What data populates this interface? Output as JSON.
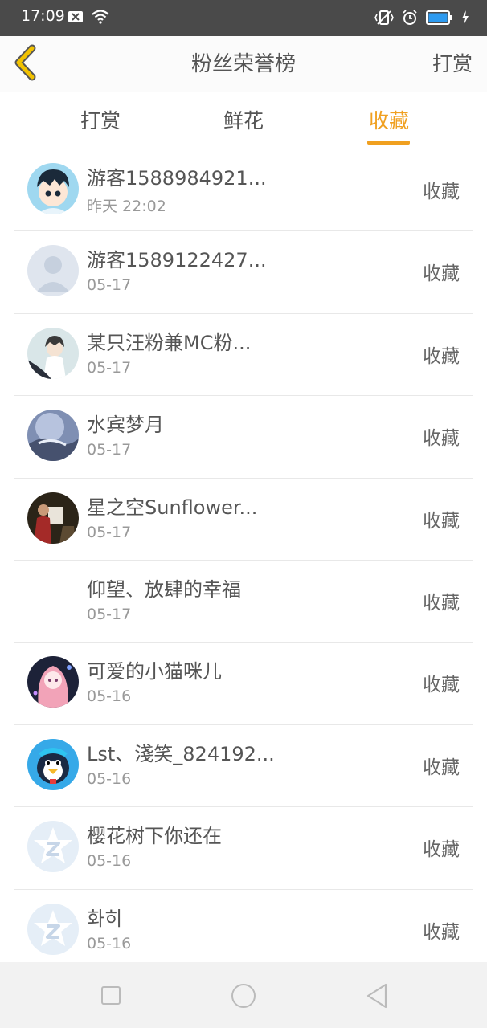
{
  "status_bar": {
    "time": "17:09",
    "left_icons": [
      "notification-x-icon",
      "wifi-icon"
    ],
    "right_icons": [
      "vibrate-icon",
      "alarm-icon",
      "battery-icon",
      "charging-icon"
    ]
  },
  "header": {
    "title": "粉丝荣誉榜",
    "right_action": "打赏",
    "accent_color": "#f0a020"
  },
  "tabs": [
    {
      "label": "打赏",
      "active": false
    },
    {
      "label": "鲜花",
      "active": false
    },
    {
      "label": "收藏",
      "active": true
    }
  ],
  "list": [
    {
      "name": "游客1588984921...",
      "date": "昨天 22:02",
      "action": "收藏",
      "avatar": "cartoon-boy-avatar"
    },
    {
      "name": "游客1589122427...",
      "date": "05-17",
      "action": "收藏",
      "avatar": "default-user-avatar"
    },
    {
      "name": "某只汪粉兼MC粉...",
      "date": "05-17",
      "action": "收藏",
      "avatar": "anime-boy-avatar"
    },
    {
      "name": "水宾梦月",
      "date": "05-17",
      "action": "收藏",
      "avatar": "landscape-avatar"
    },
    {
      "name": "星之空Sunflower...",
      "date": "05-17",
      "action": "收藏",
      "avatar": "photo-avatar"
    },
    {
      "name": "仰望、放肆的幸福",
      "date": "05-17",
      "action": "收藏",
      "avatar": "blank-avatar"
    },
    {
      "name": "可爱的小猫咪儿",
      "date": "05-16",
      "action": "收藏",
      "avatar": "anime-girl-avatar"
    },
    {
      "name": "Lst、淺笑_824192...",
      "date": "05-16",
      "action": "收藏",
      "avatar": "qq-penguin-avatar"
    },
    {
      "name": "樱花树下你还在",
      "date": "05-16",
      "action": "收藏",
      "avatar": "default-star-avatar"
    },
    {
      "name": "화히",
      "date": "05-16",
      "action": "收藏",
      "avatar": "default-star-avatar"
    }
  ],
  "bottom_nav": [
    "recent-apps-button",
    "home-button",
    "back-button"
  ]
}
